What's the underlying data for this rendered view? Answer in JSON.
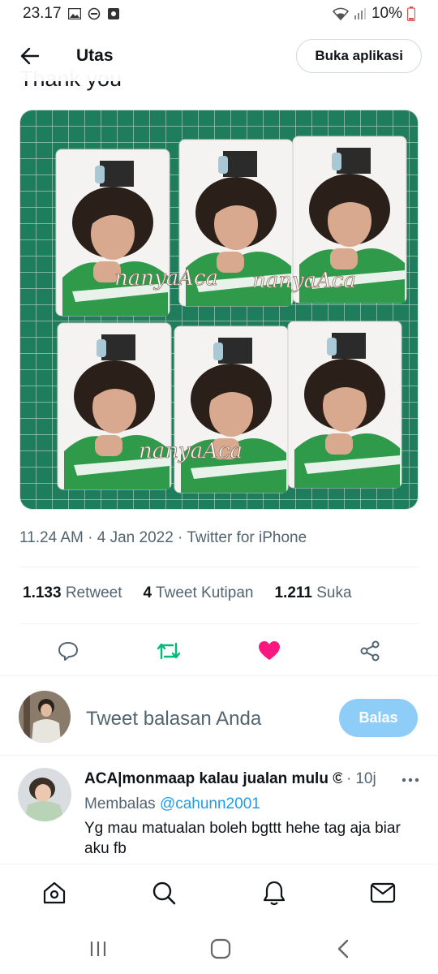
{
  "status_bar": {
    "time": "23.17",
    "battery": "10%",
    "icons": [
      "gallery-icon",
      "do-not-disturb-icon",
      "screen-record-icon",
      "wifi-icon",
      "signal-icon",
      "battery-icon"
    ]
  },
  "header": {
    "title": "Utas",
    "open_app_label": "Buka aplikasi",
    "back_icon": "arrow-left-icon"
  },
  "tweet": {
    "text": "Thank you",
    "meta": "11.24 AM · 4 Jan 2022 · Twitter for iPhone",
    "photo_watermark": "nanyaAca",
    "stats": [
      {
        "count": "1.133",
        "label": "Retweet"
      },
      {
        "count": "4",
        "label": "Tweet Kutipan"
      },
      {
        "count": "1.211",
        "label": "Suka"
      }
    ],
    "actions": [
      "reply-icon",
      "retweet-icon",
      "like-icon",
      "share-icon"
    ],
    "colors": {
      "retweet": "#00ba7c",
      "like": "#f91880",
      "icon": "#536471"
    }
  },
  "composer": {
    "placeholder": "Tweet balasan Anda",
    "reply_button": "Balas",
    "button_color": "#8ecdf8"
  },
  "reply": {
    "name": "ACA|monmaap kalau jualan mulu ©",
    "time": "10j",
    "replying_prefix": "Membalas",
    "replying_to": "@cahunn2001",
    "body": "Yg mau matualan boleh bgttt hehe tag aja biar aku fb",
    "link_color": "#1d9bf0"
  },
  "bottom_nav": [
    "home-icon",
    "search-icon",
    "notifications-icon",
    "messages-icon"
  ],
  "android_nav": [
    "recent-apps-icon",
    "home-button-icon",
    "back-icon"
  ]
}
